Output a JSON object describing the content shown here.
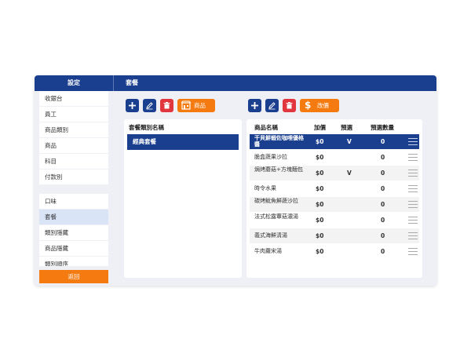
{
  "sidebar_title": "設定",
  "main_title": "套餐",
  "sidebar": {
    "items": [
      {
        "label": "收銀台"
      },
      {
        "label": "員工"
      },
      {
        "label": "商品類別"
      },
      {
        "label": "商品"
      },
      {
        "label": "科目"
      },
      {
        "label": "付款別"
      },
      {
        "label": "口味"
      },
      {
        "label": "套餐"
      },
      {
        "label": "類別隱藏"
      },
      {
        "label": "商品隱藏"
      },
      {
        "label": "類別順序"
      }
    ],
    "active": "套餐",
    "back_label": "返回"
  },
  "left_toolbar": {
    "goods_label": "商品"
  },
  "right_toolbar": {
    "price_label": "改價"
  },
  "categories": {
    "header": "套餐類別名稱",
    "items": [
      {
        "label": "經典套餐"
      }
    ]
  },
  "products": {
    "headers": {
      "name": "商品名稱",
      "price": "加價",
      "preselect": "預選",
      "preselect_qty": "預選數量"
    },
    "rows": [
      {
        "name": "干貝鮮蝦佐咖哩優格醬",
        "price": "$0",
        "preselect": "V",
        "qty": "0"
      },
      {
        "name": "脆盒蔬果沙拉",
        "price": "$0",
        "preselect": "",
        "qty": "0"
      },
      {
        "name": "焗烤蘑菇+方塊麵包",
        "price": "$0",
        "preselect": "V",
        "qty": "0"
      },
      {
        "name": "時令水果",
        "price": "$0",
        "preselect": "",
        "qty": "0"
      },
      {
        "name": "碳烤魷魚鮮蔬沙拉",
        "price": "$0",
        "preselect": "",
        "qty": "0"
      },
      {
        "name": "法式松露蕈菇濃湯",
        "price": "$0",
        "preselect": "",
        "qty": "0"
      },
      {
        "name": "義式海鮮清湯",
        "price": "$0",
        "preselect": "",
        "qty": "0"
      },
      {
        "name": "牛肉蘿宋湯",
        "price": "$0",
        "preselect": "",
        "qty": "0"
      }
    ]
  },
  "colors": {
    "primary": "#1b3f8f",
    "danger": "#e2363f",
    "accent": "#f57a10",
    "background": "#eef0f6"
  },
  "icons": {
    "add": "plus-icon",
    "edit": "pencil-icon",
    "delete": "trash-icon",
    "goods": "store-icon",
    "price": "dollar-icon",
    "drag": "drag-handle-icon"
  }
}
